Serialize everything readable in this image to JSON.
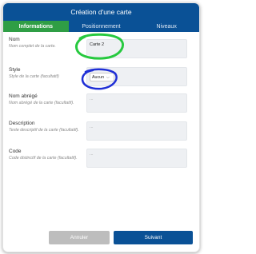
{
  "dialog": {
    "title": "Création d'une carte"
  },
  "tabs": [
    {
      "label": "Informations",
      "active": true
    },
    {
      "label": "Positionnement",
      "active": false
    },
    {
      "label": "Niveaux",
      "active": false
    }
  ],
  "fields": {
    "nom": {
      "label": "Nom",
      "hint": "Nom complet de la carte.",
      "value": "Carte 2"
    },
    "style": {
      "label": "Style",
      "hint": "Style de la carte (facultatif)",
      "value": "Aucun"
    },
    "nom_abrege": {
      "label": "Nom abrégé",
      "hint": "Nom abrégé de la carte (facultatif).",
      "placeholder": "..."
    },
    "description": {
      "label": "Description",
      "hint": "Texte descriptif de la carte (facultatif).",
      "placeholder": "..."
    },
    "code": {
      "label": "Code",
      "hint": "Code distinctif de la carte (facultatif).",
      "placeholder": "..."
    }
  },
  "buttons": {
    "cancel": "Annuler",
    "next": "Suivant"
  },
  "colors": {
    "header": "#0a5196",
    "active_tab": "#2f9e45",
    "highlight_green": "#27c93f",
    "highlight_blue": "#1f2fd6",
    "cancel_button": "#bdbdbd"
  }
}
